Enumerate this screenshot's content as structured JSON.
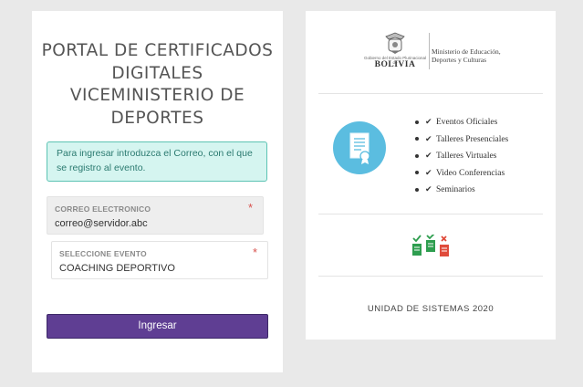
{
  "portal": {
    "title_lines": [
      "PORTAL DE CERTIFICADOS",
      "DIGITALES",
      "VICEMINISTERIO DE",
      "DEPORTES"
    ]
  },
  "info": {
    "message": "Para ingresar introduzca el Correo, con el que se registro al evento."
  },
  "form": {
    "email": {
      "label": "CORREO ELECTRONICO",
      "value": "correo@servidor.abc",
      "required_mark": "*"
    },
    "event": {
      "label": "SELECCIONE EVENTO",
      "value": "COACHING DEPORTIVO",
      "required_mark": "*"
    },
    "submit_label": "Ingresar"
  },
  "ministry": {
    "government_line": "Gobierno del Estado Plurinacional de",
    "country": "BOLIVIA",
    "name_lines": [
      "Ministerio de Educación,",
      "Deportes y Culturas"
    ]
  },
  "features": [
    "Eventos Oficiales",
    "Talleres Presenciales",
    "Talleres Virtuales",
    "Video Conferencias",
    "Seminarios"
  ],
  "icons": {
    "certificate": "certificate-icon",
    "checklist": "checklist-icon",
    "check": "checkmark-icon",
    "coat_of_arms": "coat-of-arms-icon"
  },
  "colors": {
    "primary_button": "#5f3e93",
    "info_background": "#d5f5f0",
    "info_border": "#5cc3b3",
    "certificate_circle": "#5bbde0",
    "required": "#d9534f"
  },
  "footer": {
    "text": "UNIDAD DE SISTEMAS 2020"
  }
}
